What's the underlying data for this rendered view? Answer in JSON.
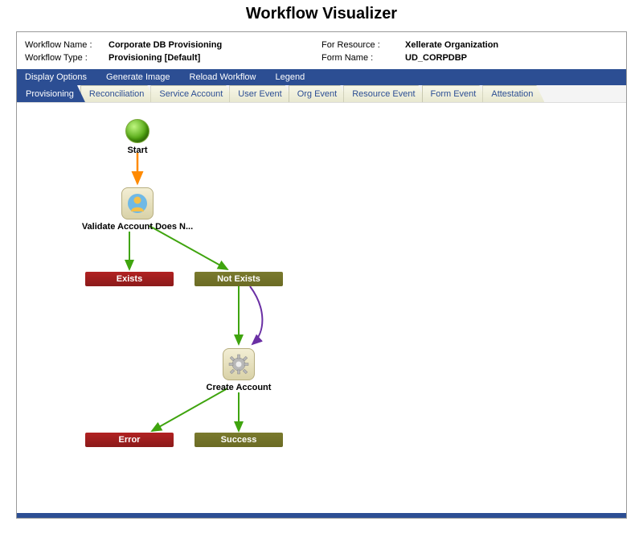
{
  "title": "Workflow Visualizer",
  "info": {
    "workflow_name_label": "Workflow Name :",
    "workflow_name_value": "Corporate DB Provisioning",
    "for_resource_label": "For Resource :",
    "for_resource_value": "Xellerate Organization",
    "workflow_type_label": "Workflow Type :",
    "workflow_type_value": "Provisioning [Default]",
    "form_name_label": "Form Name :",
    "form_name_value": "UD_CORPDBP"
  },
  "menu": {
    "display_options": "Display Options",
    "generate_image": "Generate Image",
    "reload_workflow": "Reload Workflow",
    "legend": "Legend"
  },
  "tabs": {
    "provisioning": "Provisioning",
    "reconciliation": "Reconciliation",
    "service_account": "Service Account",
    "user_event": "User Event",
    "org_event": "Org Event",
    "resource_event": "Resource Event",
    "form_event": "Form Event",
    "attestation": "Attestation"
  },
  "nodes": {
    "start": "Start",
    "validate": "Validate Account Does N...",
    "exists": "Exists",
    "not_exists": "Not Exists",
    "create": "Create Account",
    "error": "Error",
    "success": "Success"
  }
}
